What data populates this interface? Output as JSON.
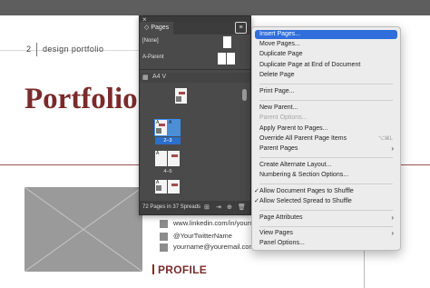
{
  "document": {
    "page_number": "2",
    "subtitle": "design portfolio",
    "title": "Portfolio",
    "contacts": [
      {
        "text": "www.linkedin.com/in/yournam"
      },
      {
        "text": "@YourTwitterName"
      },
      {
        "text": "yourname@youremail.com"
      }
    ],
    "profile_heading": "PROFILE"
  },
  "pages_panel": {
    "close_glyph": "×",
    "tab_label": "◇ Pages",
    "menu_button_glyph": "≡",
    "masters": [
      {
        "label": "[None]"
      },
      {
        "label": "A-Parent"
      }
    ],
    "page_size": "A4 V",
    "spreads": [
      {
        "label": "",
        "selected": false
      },
      {
        "label": "2–3",
        "selected": true
      },
      {
        "label": "4–5",
        "selected": false
      },
      {
        "label": "",
        "selected": false
      }
    ],
    "page_marker": "A",
    "footer_text": "72 Pages in 37 Spreads"
  },
  "flyout_menu": {
    "items": [
      {
        "label": "Insert Pages...",
        "highlighted": true
      },
      {
        "label": "Move Pages..."
      },
      {
        "label": "Duplicate Page"
      },
      {
        "label": "Duplicate Page at End of Document"
      },
      {
        "label": "Delete Page"
      },
      {
        "label": "Print Page..."
      },
      {
        "label": "New Parent..."
      },
      {
        "label": "Parent Options...",
        "disabled": true
      },
      {
        "label": "Apply Parent to Pages..."
      },
      {
        "label": "Override All Parent Page Items",
        "shortcut": "⌥⌘L"
      },
      {
        "label": "Parent Pages",
        "submenu": true
      },
      {
        "label": "Create Alternate Layout..."
      },
      {
        "label": "Numbering & Section Options..."
      },
      {
        "label": "Allow Document Pages to Shuffle",
        "checked": true
      },
      {
        "label": "Allow Selected Spread to Shuffle",
        "checked": true
      },
      {
        "label": "Page Attributes",
        "submenu": true
      },
      {
        "label": "View Pages",
        "submenu": true
      },
      {
        "label": "Panel Options..."
      }
    ],
    "submenu_arrow": "›",
    "check_glyph": "✓"
  },
  "colors": {
    "accent_red": "#7b2a2a",
    "menu_highlight": "#2f6edb",
    "panel_bg": "#4a4a4a"
  }
}
